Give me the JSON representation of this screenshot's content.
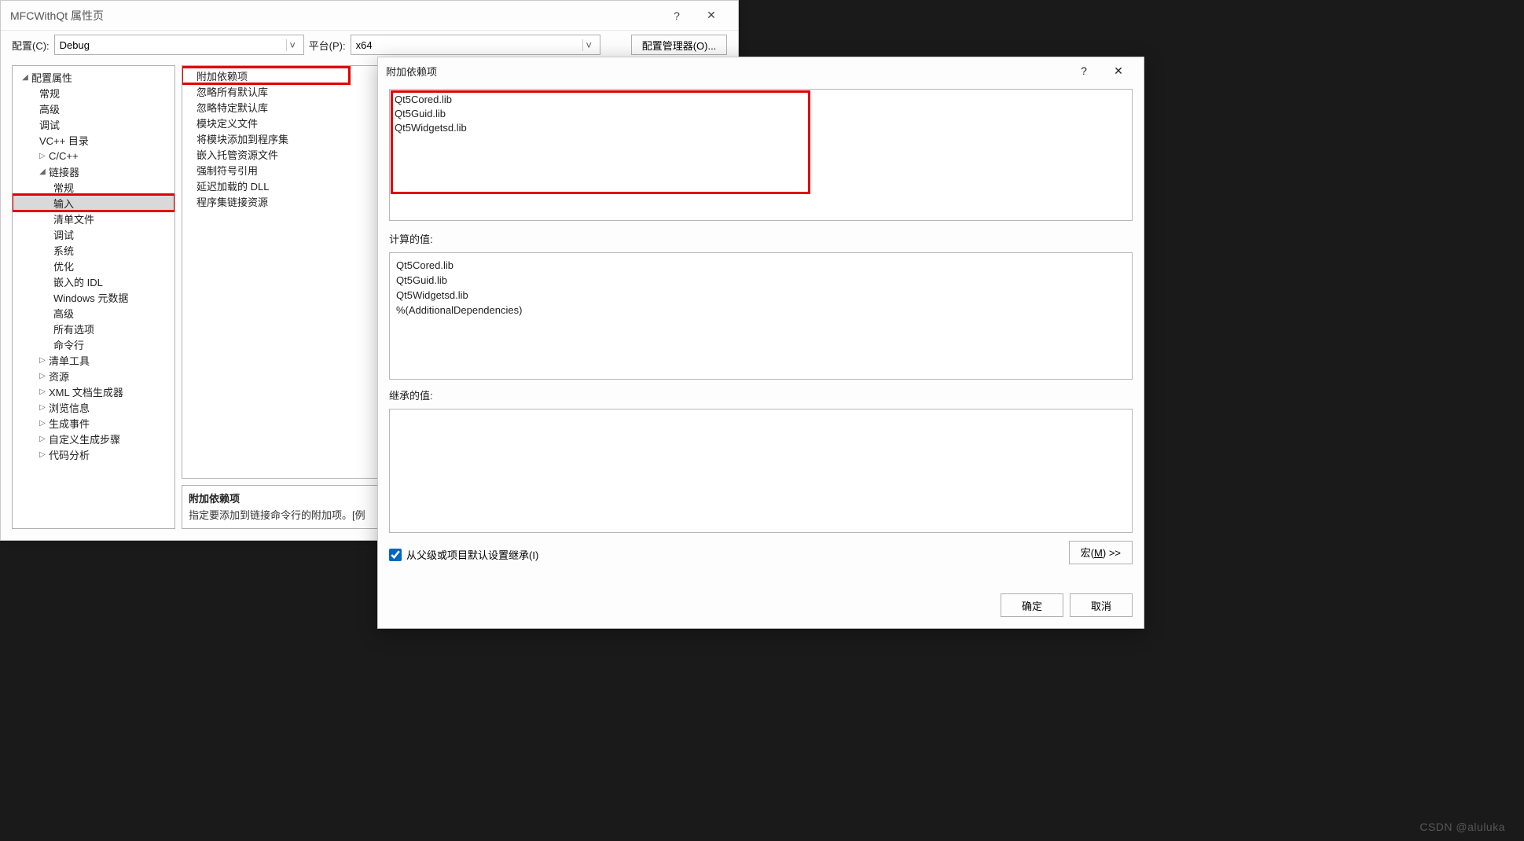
{
  "win1": {
    "title": "MFCWithQt 属性页",
    "help_icon": "?",
    "close_icon": "✕",
    "config_label": "配置(C):",
    "config_value": "Debug",
    "platform_label": "平台(P):",
    "platform_value": "x64",
    "config_manager_label": "配置管理器(O)...",
    "tree": {
      "root": "配置属性",
      "items_l2_top": [
        "常规",
        "高级",
        "调试",
        "VC++ 目录"
      ],
      "cpp": "C/C++",
      "linker": "链接器",
      "linker_children": [
        "常规",
        "输入",
        "清单文件",
        "调试",
        "系统",
        "优化",
        "嵌入的 IDL",
        "Windows 元数据",
        "高级",
        "所有选项",
        "命令行"
      ],
      "selected": "输入",
      "after": [
        "清单工具",
        "资源",
        "XML 文档生成器",
        "浏览信息",
        "生成事件",
        "自定义生成步骤",
        "代码分析"
      ]
    },
    "props": [
      "附加依赖项",
      "忽略所有默认库",
      "忽略特定默认库",
      "模块定义文件",
      "将模块添加到程序集",
      "嵌入托管资源文件",
      "强制符号引用",
      "延迟加载的 DLL",
      "程序集链接资源"
    ],
    "desc": {
      "title": "附加依赖项",
      "text": "指定要添加到链接命令行的附加项。[例"
    }
  },
  "win2": {
    "title": "附加依赖项",
    "help_icon": "?",
    "close_icon": "✕",
    "edit_text": "Qt5Cored.lib\nQt5Guid.lib\nQt5Widgetsd.lib",
    "calc_label": "计算的值:",
    "calc_lines": [
      "Qt5Cored.lib",
      "Qt5Guid.lib",
      "Qt5Widgetsd.lib",
      "%(AdditionalDependencies)"
    ],
    "inh_label": "继承的值:",
    "inh_lines": [],
    "inherit_check_label": "从父级或项目默认设置继承(I)",
    "inherit_checked": true,
    "macro_btn": {
      "prefix": "宏(",
      "u": "M",
      "suffix": ") >>"
    },
    "ok": "确定",
    "cancel": "取消"
  },
  "watermark": "CSDN @aluluka"
}
